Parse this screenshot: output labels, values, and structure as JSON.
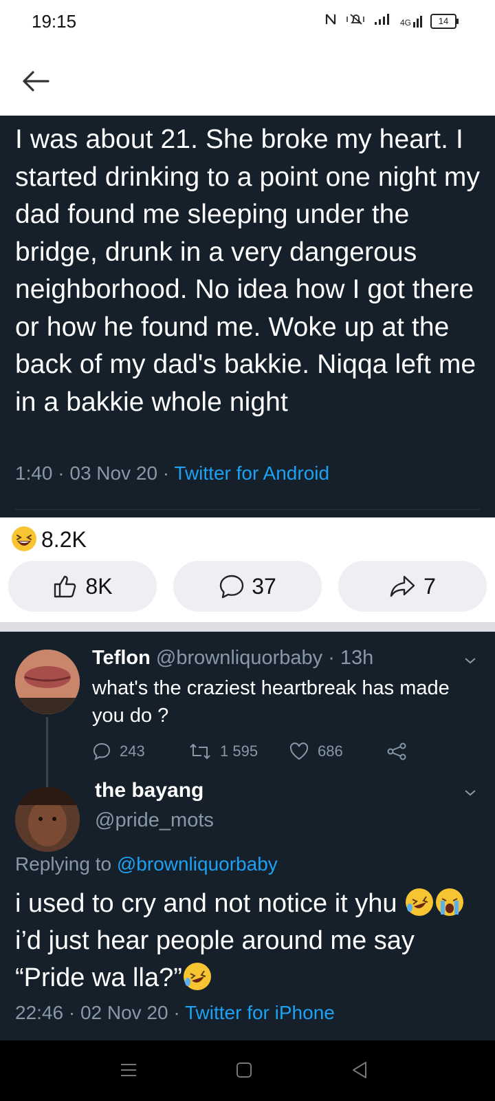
{
  "status_bar": {
    "time": "19:15",
    "network": "4G",
    "battery": "14"
  },
  "tweet": {
    "text": "I was about 21. She broke my heart. I started drinking to a point one night my dad found me sleeping under the bridge, drunk in a very dangerous neighborhood. No idea how I got there or how he found me. Woke up at the back of my dad's bakkie. Niqqa left me in a bakkie whole night",
    "time_date": "1:40 · 03 Nov 20 · ",
    "source": "Twitter for Android"
  },
  "reactions": {
    "count": "8.2K"
  },
  "actions": {
    "likes": "8K",
    "comments": "37",
    "shares": "7"
  },
  "thread": {
    "original": {
      "name": "Teflon",
      "handle_time": " @brownliquorbaby · 13h",
      "text": "what's the craziest heartbreak has made you do ?",
      "replies": "243",
      "retweets": "1 595",
      "likes": "686"
    },
    "reply": {
      "name": "the bayang",
      "handle": "@pride_mots",
      "replying_prefix": "Replying to ",
      "replying_to": "@brownliquorbaby",
      "text_part1": "i used to cry and not notice it yhu ",
      "text_part2": " i’d just hear people around me say “Pride wa lla?”",
      "time_date": "22:46 · 02 Nov 20 · ",
      "source": "Twitter for iPhone"
    }
  },
  "colors": {
    "dark_bg": "#15202b",
    "link": "#1da1f2",
    "muted": "#8899a6"
  }
}
